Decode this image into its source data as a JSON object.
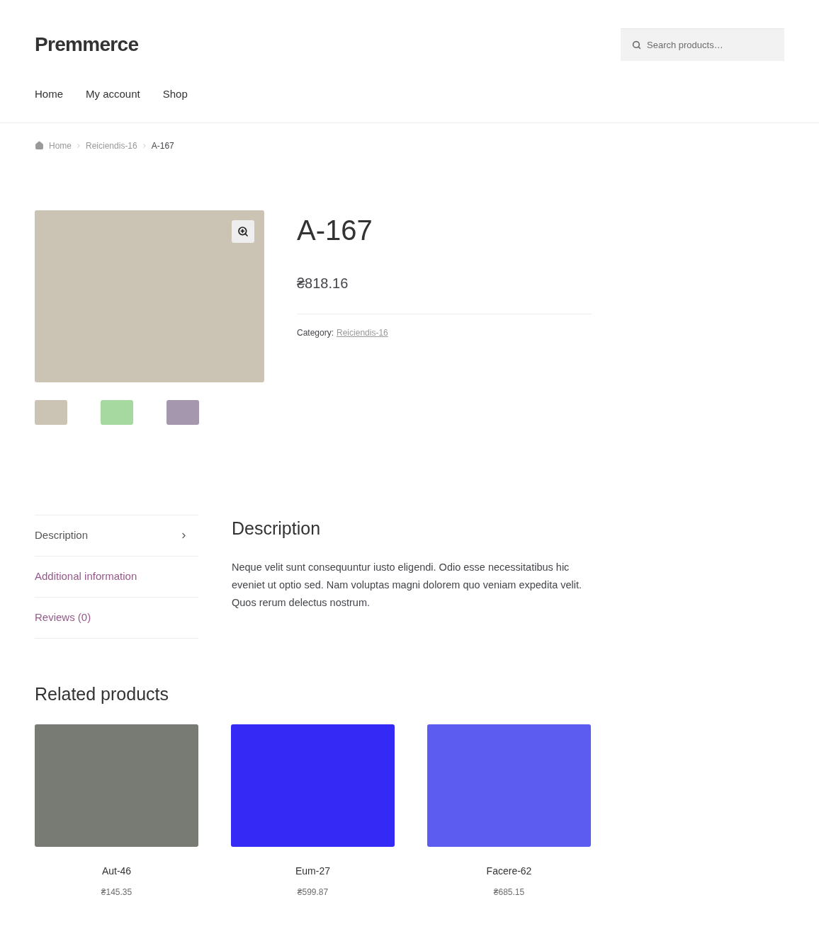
{
  "site": {
    "title": "Premmerce"
  },
  "search": {
    "placeholder": "Search products…"
  },
  "nav": [
    "Home",
    "My account",
    "Shop"
  ],
  "breadcrumb": [
    "Home",
    "Reiciendis-16",
    "A-167"
  ],
  "product": {
    "title": "A-167",
    "price": "₴818.16",
    "image": {
      "color": "#cbc3b3"
    },
    "category_label": "Category:",
    "category": "Reiciendis-16",
    "thumbnails": [
      {
        "color": "#cbc3b3"
      },
      {
        "color": "#a5d9a0"
      },
      {
        "color": "#a597ae"
      }
    ]
  },
  "tabs": [
    {
      "label": "Description",
      "selected": true
    },
    {
      "label": "Additional information",
      "selected": false
    },
    {
      "label": "Reviews (0)",
      "selected": false
    }
  ],
  "description": {
    "heading": "Description",
    "text": "Neque velit sunt consequuntur iusto eligendi. Odio esse necessitatibus hic eveniet ut optio sed. Nam voluptas magni dolorem quo veniam expedita velit. Quos rerum delectus nostrum."
  },
  "related": {
    "heading": "Related products",
    "items": [
      {
        "name": "Aut-46",
        "price": "₴145.35",
        "color": "#777b73"
      },
      {
        "name": "Eum-27",
        "price": "₴599.87",
        "color": "#3429f5"
      },
      {
        "name": "Facere-62",
        "price": "₴685.15",
        "color": "#5c5cf0"
      }
    ]
  }
}
